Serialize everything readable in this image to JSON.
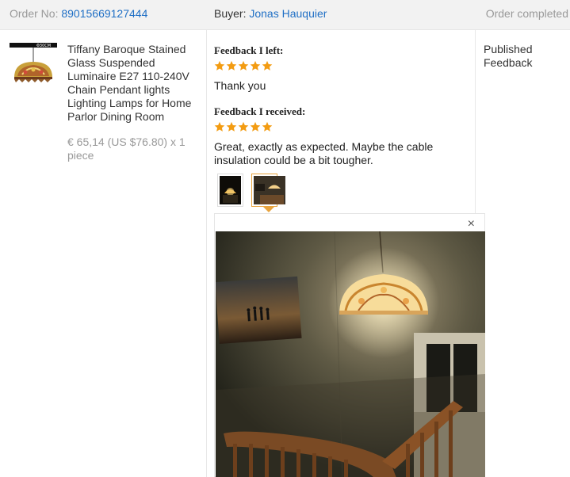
{
  "order": {
    "number_label": "Order No:",
    "number": "89015669127444",
    "buyer_label": "Buyer:",
    "buyer_name": "Jonas Hauquier",
    "status": "Order completed"
  },
  "product": {
    "thumb_caption": "Φ30CM",
    "title": "Tiffany Baroque Stained Glass Suspended Luminaire E27 110-240V Chain Pendant lights Lighting Lamps for Home Parlor Dining Room",
    "price": "€ 65,14 (US $76.80) x 1 piece"
  },
  "feedback_left": {
    "heading": "Feedback I left:",
    "rating": 5,
    "text": "Thank you"
  },
  "feedback_received": {
    "heading": "Feedback I received:",
    "rating": 5,
    "text": "Great, exactly as expected. Maybe the cable insulation could be a bit tougher."
  },
  "photos": {
    "count": 2,
    "active_index": 1,
    "close_symbol": "×"
  },
  "status_column": {
    "line1": "Published",
    "line2": "Feedback"
  },
  "colors": {
    "link": "#1f6fc5",
    "star": "#f39c12",
    "active_border": "#e8a33d",
    "header_bg": "#f2f2f2"
  },
  "icons": [
    "star-icon",
    "close-icon"
  ]
}
